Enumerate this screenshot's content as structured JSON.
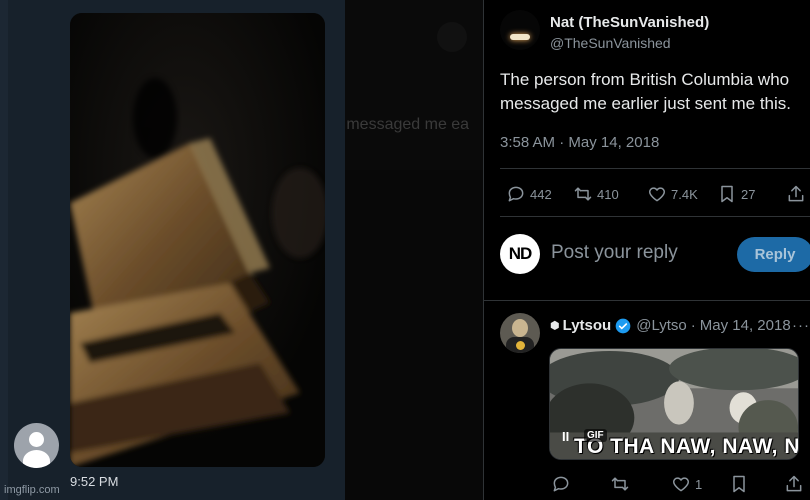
{
  "chat": {
    "timestamp": "9:52 PM",
    "watermark": "imgflip.com"
  },
  "background": {
    "ghost_text": "o messaged me ea"
  },
  "tweet": {
    "author_name": "Nat (TheSunVanished)",
    "author_handle": "@TheSunVanished",
    "text": "The person from British Columbia who messaged me earlier just sent me this.",
    "time": "3:58 AM",
    "separator": "·",
    "date": "May 14, 2018",
    "stats": {
      "replies": "442",
      "retweets": "410",
      "likes": "7.4K",
      "bookmarks": "27"
    }
  },
  "composer": {
    "avatar_text": "ND",
    "placeholder": "Post your reply",
    "button_label": "Reply"
  },
  "reply": {
    "name": "Lytsou",
    "handle": "@Lytso",
    "separator": "·",
    "date": "May 14, 2018",
    "more": "···",
    "gif_caption": "TO THA NAW, NAW, NAW",
    "gif_badge": "GIF",
    "gif_pause": "II",
    "stats": {
      "likes": "1"
    }
  },
  "colors": {
    "accent": "#1d9bf0",
    "reply_button": "#1d6aa6",
    "chat_bg": "#17212b",
    "muted_text": "#8b949c"
  },
  "icons": [
    "reply-icon",
    "retweet-icon",
    "like-icon",
    "bookmark-icon",
    "share-icon",
    "verified-icon",
    "more-icon",
    "pause-icon"
  ]
}
